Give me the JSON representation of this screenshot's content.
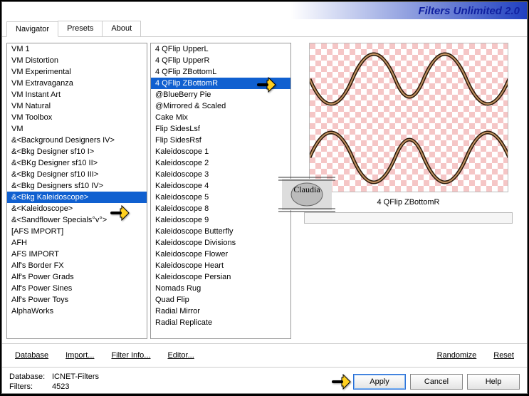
{
  "title": "Filters Unlimited 2.0",
  "tabs": {
    "navigator": "Navigator",
    "presets": "Presets",
    "about": "About"
  },
  "categories": [
    "VM 1",
    "VM Distortion",
    "VM Experimental",
    "VM Extravaganza",
    "VM Instant Art",
    "VM Natural",
    "VM Toolbox",
    "VM",
    "&<Background Designers IV>",
    "&<Bkg Designer sf10 I>",
    "&<BKg Designer sf10 II>",
    "&<Bkg Designer sf10 III>",
    "&<Bkg Designers sf10 IV>",
    "&<Bkg Kaleidoscope>",
    "&<Kaleidoscope>",
    "&<Sandflower Specials°v°>",
    "[AFS IMPORT]",
    "AFH",
    "AFS IMPORT",
    "Alf's Border FX",
    "Alf's Power Grads",
    "Alf's Power Sines",
    "Alf's Power Toys",
    "AlphaWorks"
  ],
  "selectedCategoryIndex": 13,
  "filters": [
    "4 QFlip UpperL",
    "4 QFlip UpperR",
    "4 QFlip ZBottomL",
    "4 QFlip ZBottomR",
    "@BlueBerry Pie",
    "@Mirrored & Scaled",
    "Cake Mix",
    "Flip SidesLsf",
    "Flip SidesRsf",
    "Kaleidoscope 1",
    "Kaleidoscope 2",
    "Kaleidoscope 3",
    "Kaleidoscope 4",
    "Kaleidoscope 5",
    "Kaleidoscope 8",
    "Kaleidoscope 9",
    "Kaleidoscope Butterfly",
    "Kaleidoscope Divisions",
    "Kaleidoscope Flower",
    "Kaleidoscope Heart",
    "Kaleidoscope Persian",
    "Nomads Rug",
    "Quad Flip",
    "Radial Mirror",
    "Radial Replicate"
  ],
  "selectedFilterIndex": 3,
  "selectedFilterName": "4 QFlip ZBottomR",
  "links": {
    "database": "Database",
    "import": "Import...",
    "filterinfo": "Filter Info...",
    "editor": "Editor...",
    "randomize": "Randomize",
    "reset": "Reset"
  },
  "status": {
    "db_label": "Database:",
    "db_value": "ICNET-Filters",
    "filters_label": "Filters:",
    "filters_value": "4523"
  },
  "buttons": {
    "apply": "Apply",
    "cancel": "Cancel",
    "help": "Help"
  },
  "watermark": "Claudia"
}
